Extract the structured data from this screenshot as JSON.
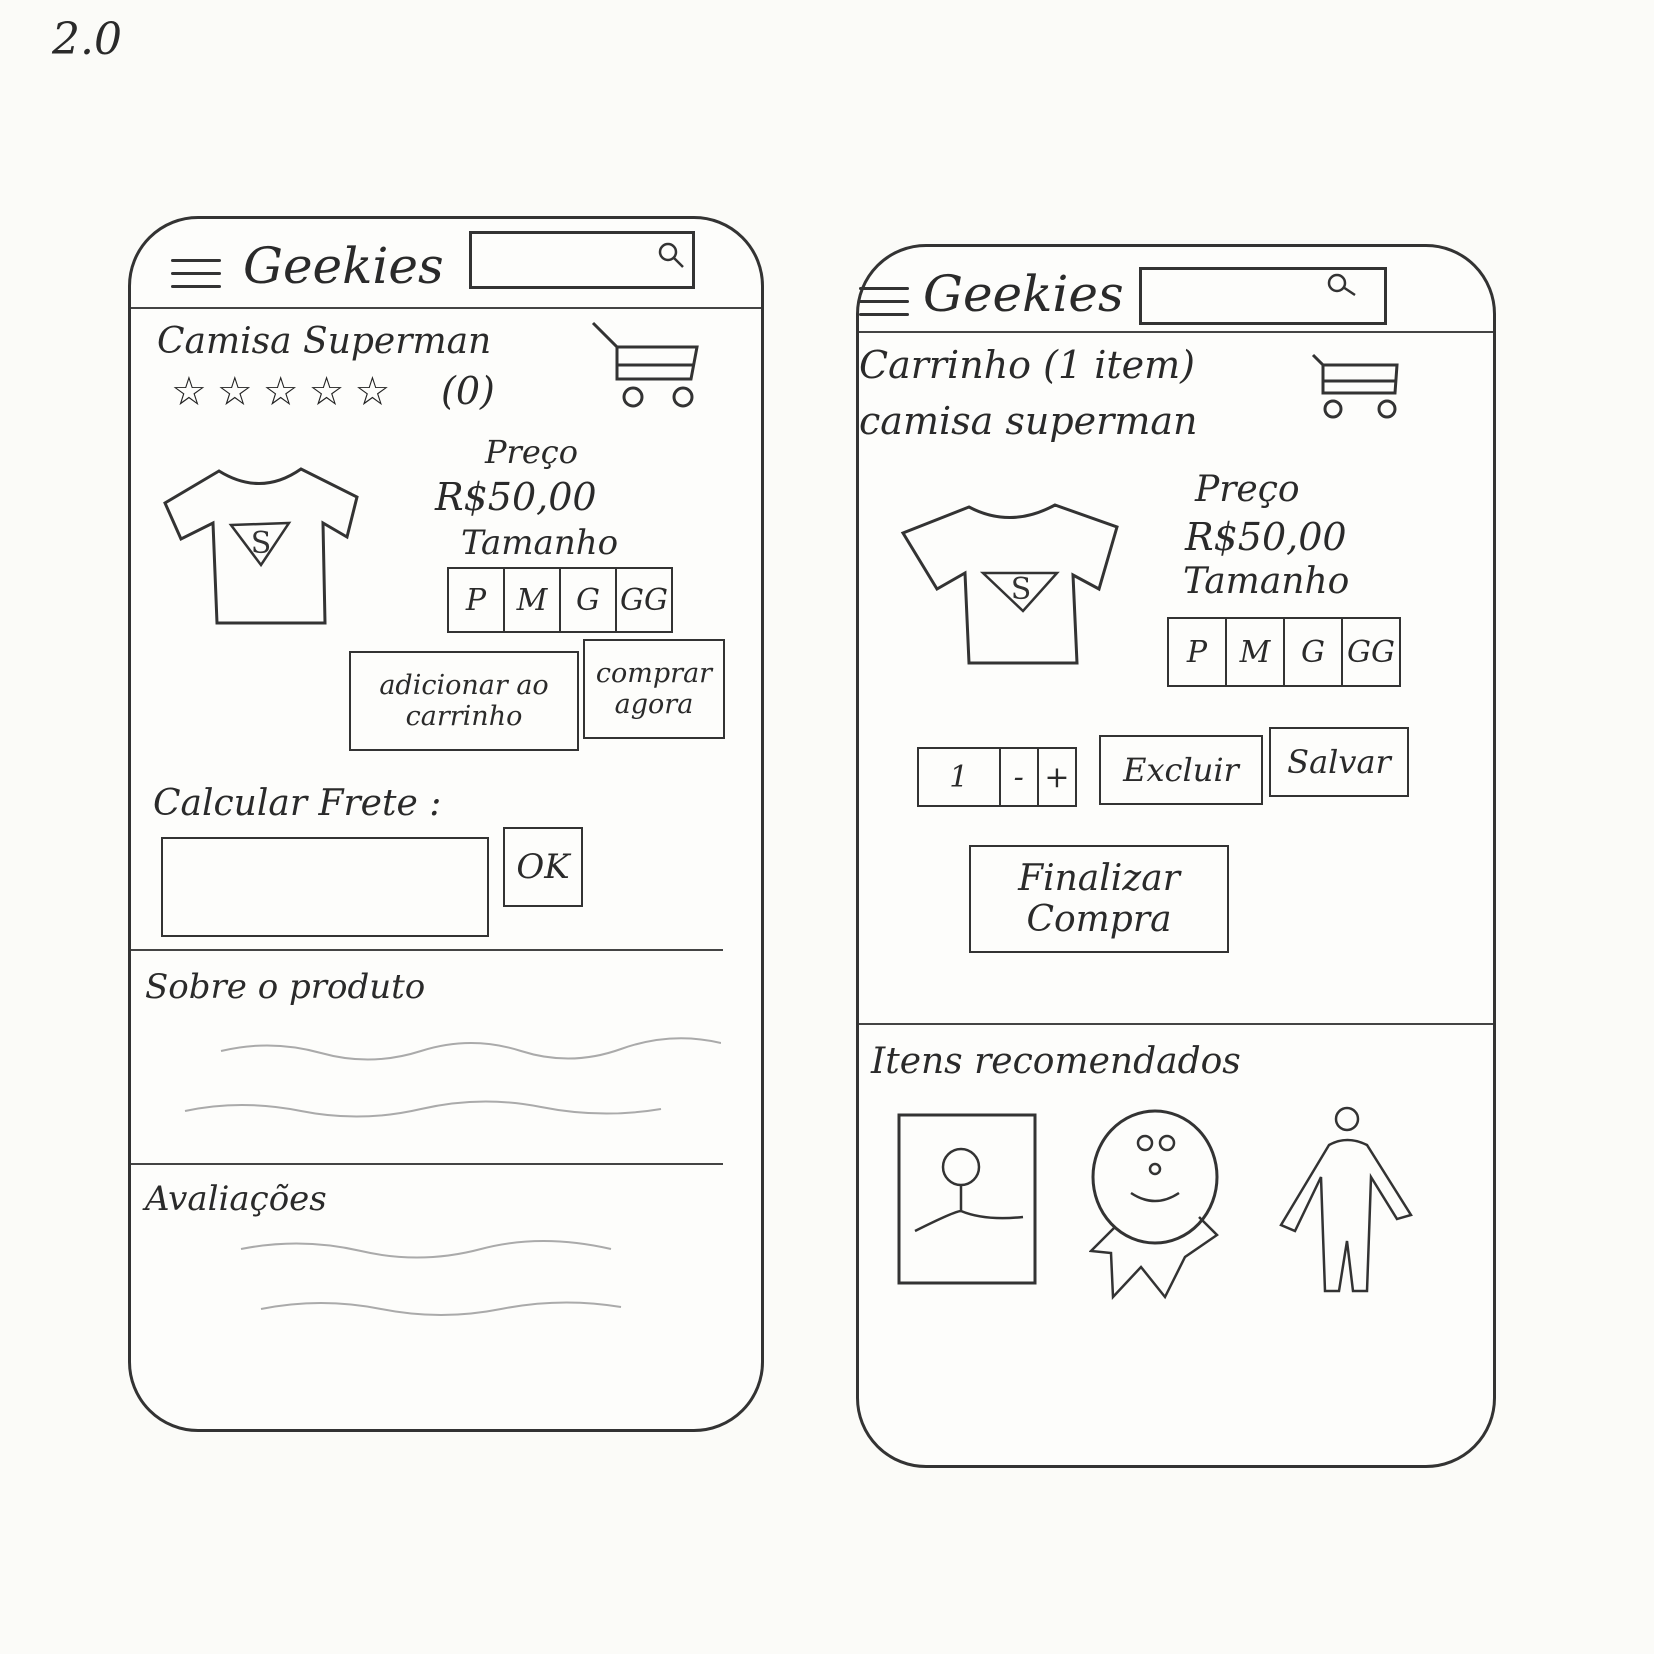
{
  "version": "2.0",
  "brand": "Geekies",
  "product_screen": {
    "product_name": "Camisa Superman",
    "rating": 5,
    "rating_count": "(0)",
    "price_label": "Preço",
    "price": "R$50,00",
    "size_label": "Tamanho",
    "sizes": [
      "P",
      "M",
      "G",
      "GG"
    ],
    "add_to_cart": "adicionar ao carrinho",
    "buy_now": "comprar agora",
    "shipping_label": "Calcular Frete :",
    "ok": "OK",
    "about_label": "Sobre o produto",
    "reviews_label": "Avaliações"
  },
  "cart_screen": {
    "cart_title": "Carrinho (1 item)",
    "product_name": "camisa superman",
    "price_label": "Preço",
    "price": "R$50,00",
    "size_label": "Tamanho",
    "sizes": [
      "P",
      "M",
      "G",
      "GG"
    ],
    "quantity": "1",
    "minus": "-",
    "plus": "+",
    "delete": "Excluir",
    "save": "Salvar",
    "checkout": "Finalizar Compra",
    "recommended_label": "Itens recomendados"
  },
  "icons": [
    "menu-icon",
    "search-icon",
    "cart-icon",
    "tshirt-image",
    "poster-image",
    "plush-image",
    "figure-image"
  ]
}
